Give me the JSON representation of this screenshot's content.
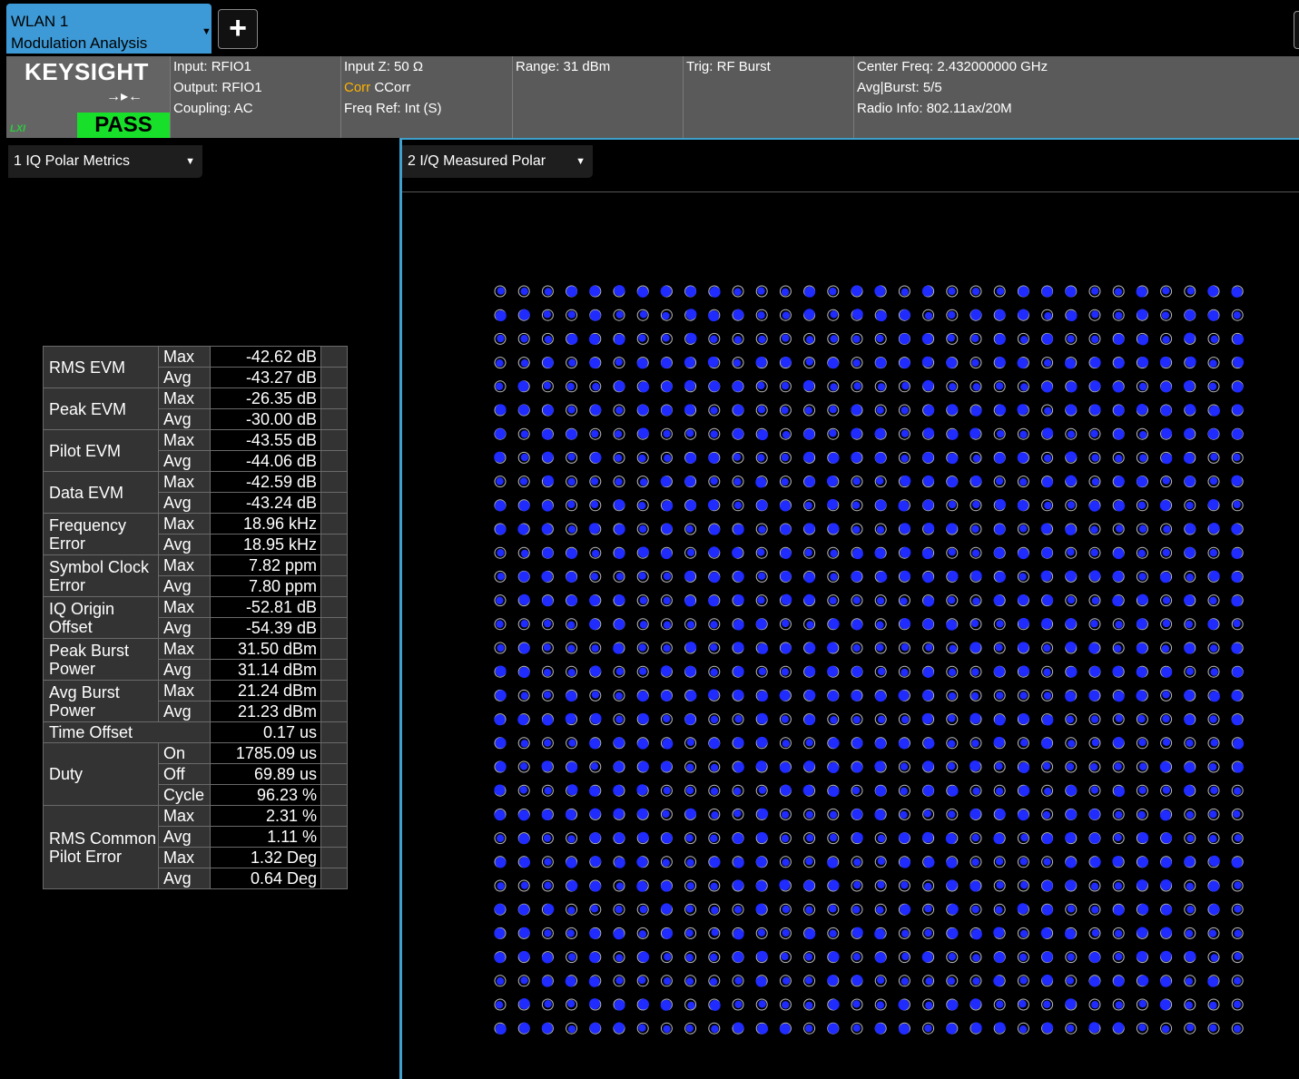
{
  "tab": {
    "line1": "WLAN 1",
    "line2": "Modulation Analysis",
    "add_label": "+"
  },
  "header": {
    "logo": "KEYSIGHT",
    "lxi": "LXI",
    "status": "PASS",
    "input": "Input: RFIO1",
    "output": "Output: RFIO1",
    "coupling": "Coupling: AC",
    "input_z": "Input Z: 50 Ω",
    "corr_prefix": "Corr",
    "corr_value": "CCorr",
    "freq_ref": "Freq Ref: Int (S)",
    "range": "Range: 31 dBm",
    "trig": "Trig: RF Burst",
    "center_freq": "Center Freq: 2.432000000 GHz",
    "avg_burst": "Avg|Burst: 5/5",
    "radio_info": "Radio Info: 802.11ax/20M"
  },
  "left_window": {
    "title": "1 IQ Polar Metrics"
  },
  "right_window": {
    "title": "2 I/Q Measured Polar"
  },
  "metrics": [
    {
      "name": "RMS EVM",
      "rows": [
        {
          "stat": "Max",
          "value": "-42.62 dB"
        },
        {
          "stat": "Avg",
          "value": "-43.27 dB"
        }
      ]
    },
    {
      "name": "Peak EVM",
      "rows": [
        {
          "stat": "Max",
          "value": "-26.35 dB"
        },
        {
          "stat": "Avg",
          "value": "-30.00 dB"
        }
      ]
    },
    {
      "name": "Pilot EVM",
      "rows": [
        {
          "stat": "Max",
          "value": "-43.55 dB"
        },
        {
          "stat": "Avg",
          "value": "-44.06 dB"
        }
      ]
    },
    {
      "name": "Data EVM",
      "rows": [
        {
          "stat": "Max",
          "value": "-42.59 dB"
        },
        {
          "stat": "Avg",
          "value": "-43.24 dB"
        }
      ]
    },
    {
      "name": "Frequency Error",
      "rows": [
        {
          "stat": "Max",
          "value": "18.96 kHz"
        },
        {
          "stat": "Avg",
          "value": "18.95 kHz"
        }
      ]
    },
    {
      "name": "Symbol Clock Error",
      "rows": [
        {
          "stat": "Max",
          "value": "7.82 ppm"
        },
        {
          "stat": "Avg",
          "value": "7.80 ppm"
        }
      ]
    },
    {
      "name": "IQ Origin Offset",
      "rows": [
        {
          "stat": "Max",
          "value": "-52.81 dB"
        },
        {
          "stat": "Avg",
          "value": "-54.39 dB"
        }
      ]
    },
    {
      "name": "Peak Burst Power",
      "rows": [
        {
          "stat": "Max",
          "value": "31.50 dBm"
        },
        {
          "stat": "Avg",
          "value": "31.14 dBm"
        }
      ]
    },
    {
      "name": "Avg Burst Power",
      "rows": [
        {
          "stat": "Max",
          "value": "21.24 dBm"
        },
        {
          "stat": "Avg",
          "value": "21.23 dBm"
        }
      ]
    },
    {
      "name": "Time Offset",
      "rows": [
        {
          "stat": "",
          "value": "0.17 us"
        }
      ]
    },
    {
      "name": "Duty",
      "rows": [
        {
          "stat": "On",
          "value": "1785.09 us"
        },
        {
          "stat": "Off",
          "value": "69.89 us"
        },
        {
          "stat": "Cycle",
          "value": "96.23 %"
        }
      ]
    },
    {
      "name": "RMS Common Pilot Error",
      "rows": [
        {
          "stat": "Max",
          "value": "2.31 %"
        },
        {
          "stat": "Avg",
          "value": "1.11 %"
        },
        {
          "stat": "Max",
          "value": "1.32  Deg"
        },
        {
          "stat": "Avg",
          "value": "0.64  Deg"
        }
      ]
    }
  ],
  "constellation": {
    "grid_size": 32,
    "ref_color": "#bbbbbb",
    "symbol_color": "#1f2bff",
    "background": "#000000"
  }
}
